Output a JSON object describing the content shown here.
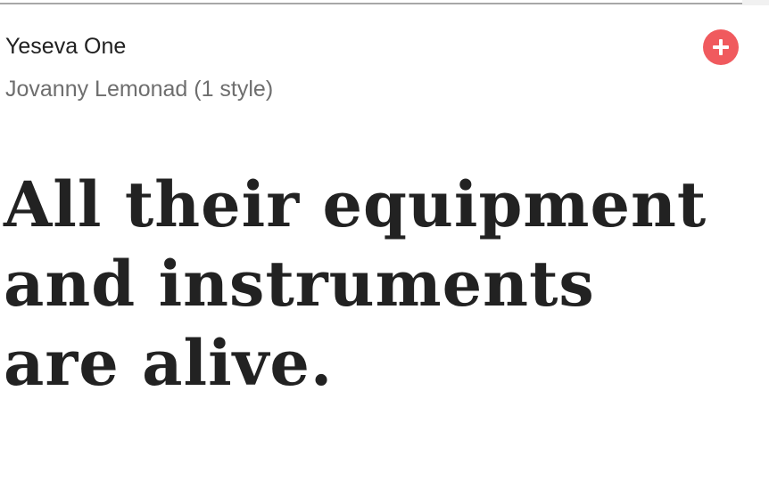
{
  "font_card": {
    "font_name": "Yeseva One",
    "designer": "Jovanny Lemonad (1 style)",
    "add_button_icon": "plus-icon",
    "accent_color": "#f05a5e",
    "sample_lines": [
      "All their equipment",
      "and instruments",
      "are alive."
    ]
  }
}
